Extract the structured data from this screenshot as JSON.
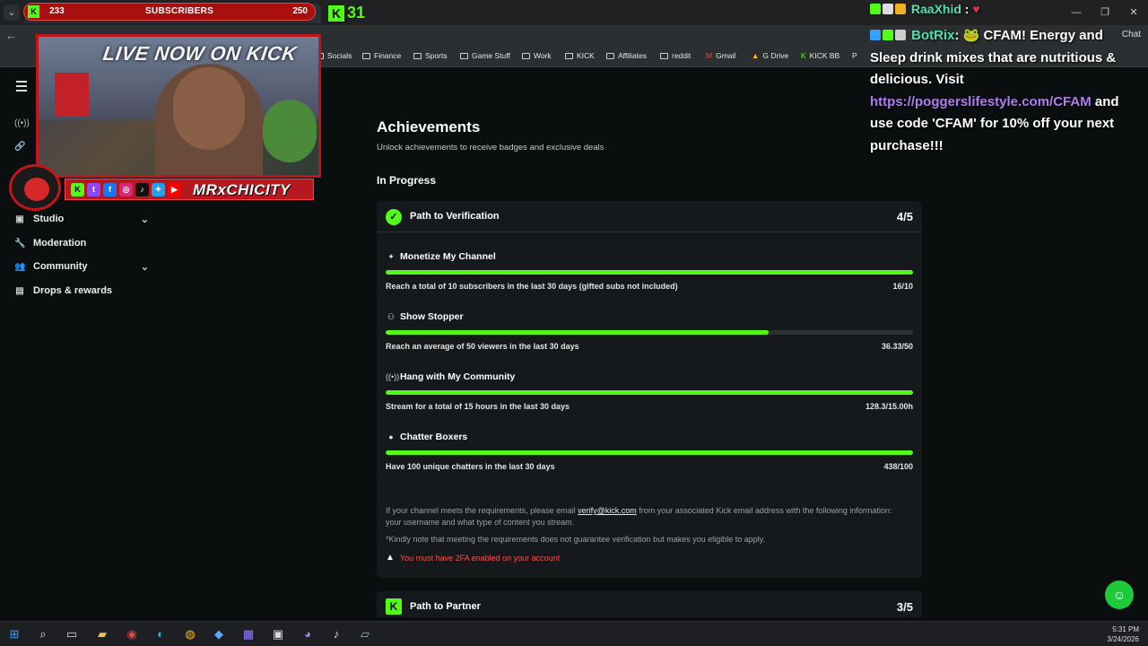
{
  "overlay": {
    "subs_current": "233",
    "subs_label": "SUBSCRIBERS",
    "subs_goal": "250",
    "kick_count": "31",
    "live_text": "LIVE NOW ON KICK",
    "streamer_name": "MRxCHICITY"
  },
  "chat": {
    "user1": "RaaXhid",
    "user1_sep": ":",
    "user2": "BotRix",
    "message_pre": ": 🐸 CFAM! Energy and Sleep drink mixes that are nutritious & delicious. Visit ",
    "url": "https://poggerslifestyle.com/CFAM",
    "message_post": " and use code 'CFAM' for 10% off your next purchase!!!"
  },
  "browser": {
    "chat_button": "Chat",
    "bookmarks": [
      "Socials",
      "Finance",
      "Sports",
      "Game Stuff",
      "Work",
      "KICK",
      "Affiliates",
      "reddit",
      "Gmail",
      "G Drive",
      "KICK BB",
      "P"
    ]
  },
  "sidebar": {
    "items": [
      {
        "label": "Studio",
        "icon": "studio-icon"
      },
      {
        "label": "Moderation",
        "icon": "wrench-icon"
      },
      {
        "label": "Community",
        "icon": "community-icon"
      },
      {
        "label": "Drops & rewards",
        "icon": "rewards-icon"
      }
    ]
  },
  "page": {
    "title": "Achievements",
    "subtitle": "Unlock achievements to receive badges and exclusive deals",
    "section": "In Progress"
  },
  "verification": {
    "title": "Path to Verification",
    "count": "4/5",
    "achievements": [
      {
        "title": "Monetize My Channel",
        "icon": "sparkle-icon",
        "desc": "Reach a total of 10 subscribers in the last 30 days (gifted subs not included)",
        "value": "16/10",
        "progress": 1.0
      },
      {
        "title": "Show Stopper",
        "icon": "viewers-icon",
        "desc": "Reach an average of 50 viewers in the last 30 days",
        "value": "36.33/50",
        "progress": 0.7266
      },
      {
        "title": "Hang with My Community",
        "icon": "broadcast-icon",
        "desc": "Stream for a total of 15 hours in the last 30 days",
        "value": "128.3/15.00h",
        "progress": 1.0
      },
      {
        "title": "Chatter Boxers",
        "icon": "chat-bubble-icon",
        "desc": "Have 100 unique chatters in the last 30 days",
        "value": "438/100",
        "progress": 1.0
      }
    ],
    "note_pre": "If your channel meets the requirements, please email ",
    "note_email": "verify@kick.com",
    "note_post": " from your associated Kick email address with the following information: your username and what type of content you stream.",
    "note2": "*Kindly note that meeting the requirements does not guarantee verification but makes you eligible to apply.",
    "warning": "You must have 2FA enabled on your account"
  },
  "partner": {
    "title": "Path to Partner",
    "count": "3/5"
  },
  "taskbar": {
    "time": "5:31 PM",
    "date": "3/24/2026"
  },
  "colors": {
    "accent": "#53fc18",
    "background": "#0b0e0f",
    "card": "#16191b",
    "warning": "#ff4d4d"
  }
}
